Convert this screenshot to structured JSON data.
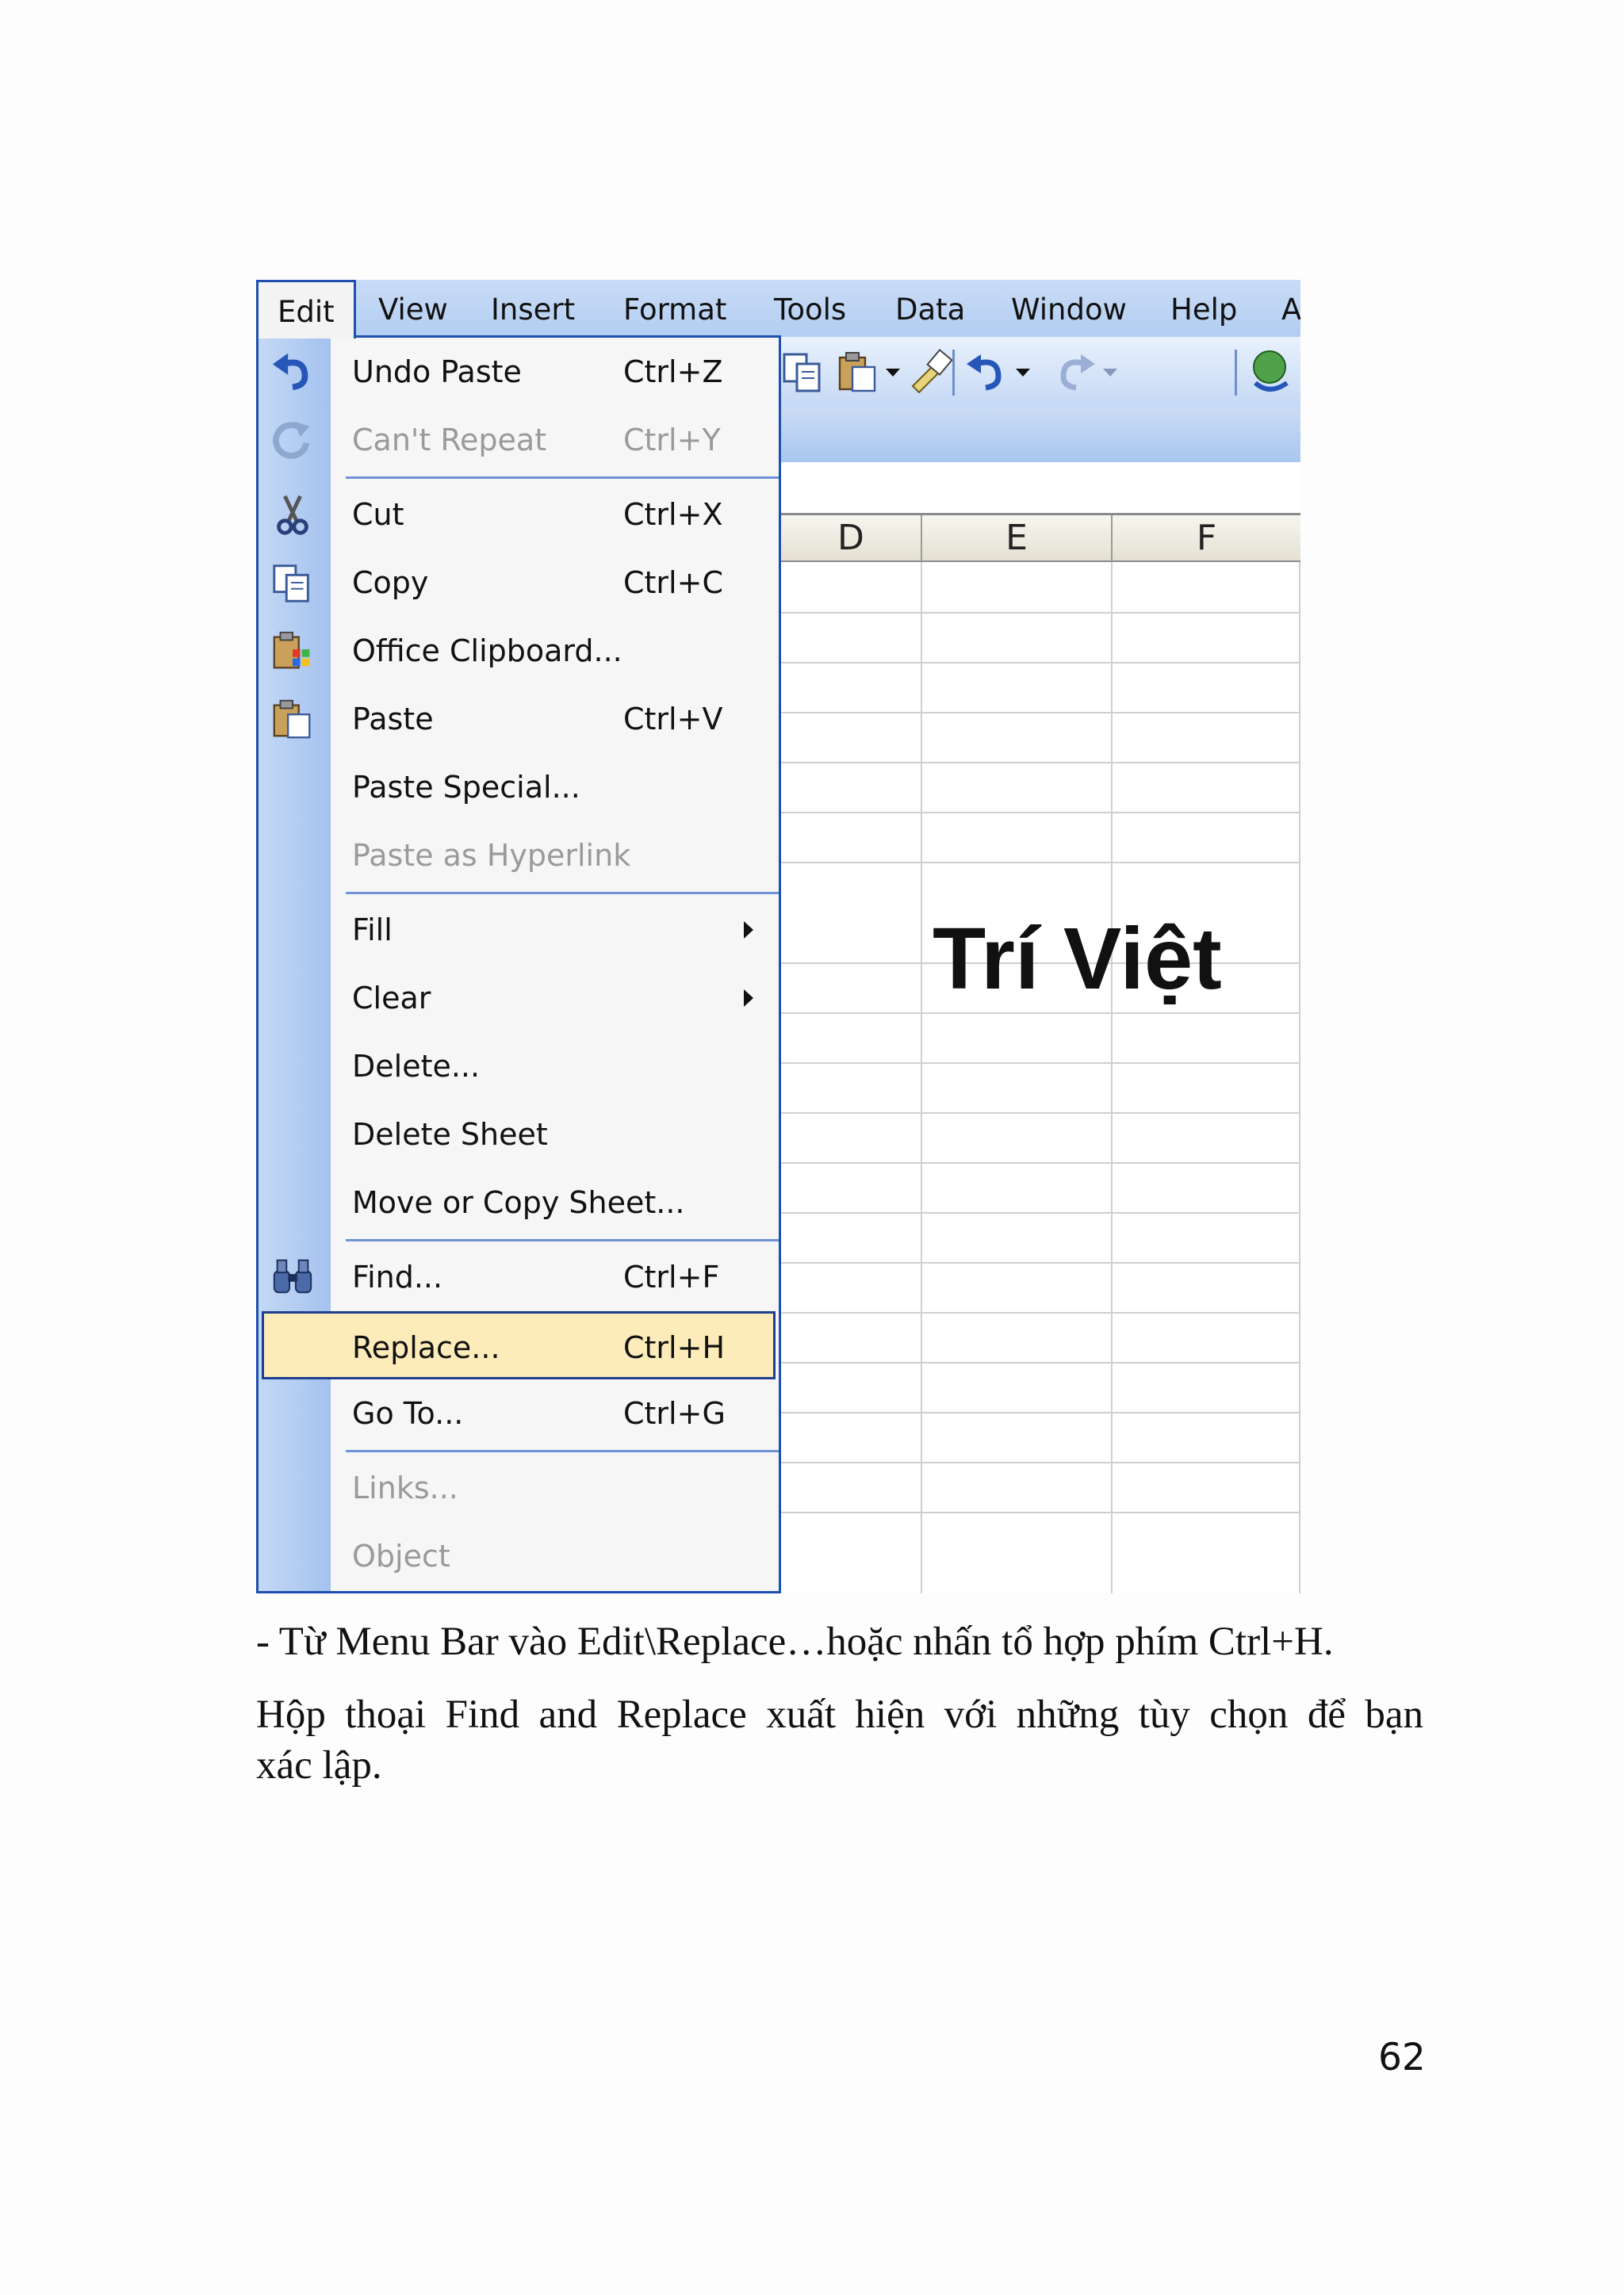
{
  "menubar": {
    "items": [
      "Edit",
      "View",
      "Insert",
      "Format",
      "Tools",
      "Data",
      "Window",
      "Help",
      "A"
    ],
    "open_item": "Edit"
  },
  "toolbar": {
    "icons": [
      "copy-icon",
      "paste-icon",
      "dropdown-arrow-icon",
      "format-painter-icon",
      "undo-icon",
      "dropdown-arrow-icon",
      "redo-icon",
      "dropdown-arrow-icon",
      "hyperlink-icon"
    ]
  },
  "sheet": {
    "columns": [
      "D",
      "E",
      "F"
    ],
    "cell_text": "Trí Việt"
  },
  "edit_menu": {
    "items": [
      {
        "label": "Undo Paste",
        "shortcut": "Ctrl+Z",
        "icon": "undo-icon",
        "disabled": false
      },
      {
        "label": "Can't Repeat",
        "shortcut": "Ctrl+Y",
        "icon": "repeat-icon",
        "disabled": true
      },
      {
        "label": "Cut",
        "shortcut": "Ctrl+X",
        "icon": "scissors-icon",
        "disabled": false
      },
      {
        "label": "Copy",
        "shortcut": "Ctrl+C",
        "icon": "copy-icon",
        "disabled": false
      },
      {
        "label": "Office Clipboard...",
        "shortcut": "",
        "icon": "clipboard-icon",
        "disabled": false
      },
      {
        "label": "Paste",
        "shortcut": "Ctrl+V",
        "icon": "paste-icon",
        "disabled": false
      },
      {
        "label": "Paste Special...",
        "shortcut": "",
        "icon": "",
        "disabled": false
      },
      {
        "label": "Paste as Hyperlink",
        "shortcut": "",
        "icon": "",
        "disabled": true
      },
      {
        "label": "Fill",
        "shortcut": "",
        "icon": "",
        "disabled": false,
        "submenu": true
      },
      {
        "label": "Clear",
        "shortcut": "",
        "icon": "",
        "disabled": false,
        "submenu": true
      },
      {
        "label": "Delete...",
        "shortcut": "",
        "icon": "",
        "disabled": false
      },
      {
        "label": "Delete Sheet",
        "shortcut": "",
        "icon": "",
        "disabled": false
      },
      {
        "label": "Move or Copy Sheet...",
        "shortcut": "",
        "icon": "",
        "disabled": false
      },
      {
        "label": "Find...",
        "shortcut": "Ctrl+F",
        "icon": "binoculars-icon",
        "disabled": false
      },
      {
        "label": "Replace...",
        "shortcut": "Ctrl+H",
        "icon": "",
        "disabled": false,
        "highlighted": true
      },
      {
        "label": "Go To...",
        "shortcut": "Ctrl+G",
        "icon": "",
        "disabled": false
      },
      {
        "label": "Links...",
        "shortcut": "",
        "icon": "",
        "disabled": true
      },
      {
        "label": "Object",
        "shortcut": "",
        "icon": "",
        "disabled": true
      }
    ]
  },
  "caption": {
    "line1": "- Từ Menu Bar vào Edit\\Replace…hoặc nhấn tổ hợp phím Ctrl+H.",
    "line2": "Hộp thoại Find and Replace xuất hiện với những tùy chọn để bạn",
    "line3": "xác lập."
  },
  "page_number": "62"
}
